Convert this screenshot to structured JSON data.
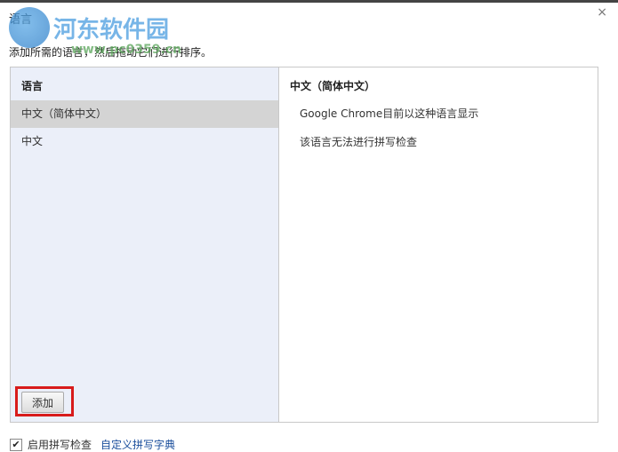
{
  "dialog": {
    "title": "语言",
    "subtitle": "添加所需的语言，然后拖动它们进行排序。",
    "close": "×"
  },
  "watermark": {
    "name": "河东软件园",
    "url": "www.pc0359.cn"
  },
  "languages": {
    "header": "语言",
    "items": [
      {
        "label": "中文（简体中文）",
        "selected": true
      },
      {
        "label": "中文",
        "selected": false
      }
    ],
    "add_button": "添加"
  },
  "details": {
    "header": "中文（简体中文）",
    "lines": [
      "Google Chrome目前以这种语言显示",
      "该语言无法进行拼写检查"
    ]
  },
  "footer": {
    "spellcheck_label": "启用拼写检查",
    "spellcheck_checked": true,
    "custom_dict_link": "自定义拼写字典"
  }
}
